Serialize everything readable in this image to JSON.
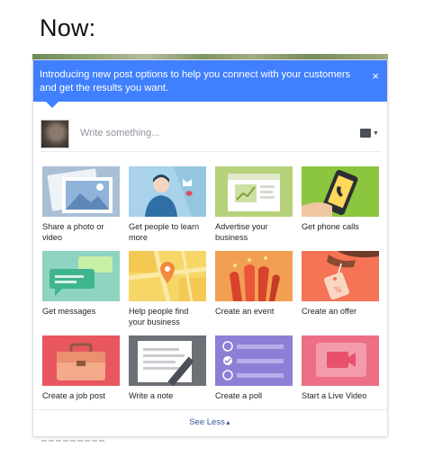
{
  "heading": "Now:",
  "banner": {
    "text": "Introducing new post options to help you connect with your customers and get the results you want.",
    "close_label": "×"
  },
  "composer": {
    "placeholder": "Write something..."
  },
  "options": [
    {
      "label": "Share a photo or video",
      "icon": "photo-icon"
    },
    {
      "label": "Get people to learn more",
      "icon": "person-learn-icon"
    },
    {
      "label": "Advertise your business",
      "icon": "advertise-icon"
    },
    {
      "label": "Get phone calls",
      "icon": "phone-icon"
    },
    {
      "label": "Get messages",
      "icon": "messages-icon"
    },
    {
      "label": "Help people find your business",
      "icon": "map-pin-icon"
    },
    {
      "label": "Create an event",
      "icon": "event-icon"
    },
    {
      "label": "Create an offer",
      "icon": "offer-tag-icon"
    },
    {
      "label": "Create a job post",
      "icon": "briefcase-icon"
    },
    {
      "label": "Write a note",
      "icon": "note-icon"
    },
    {
      "label": "Create a poll",
      "icon": "poll-icon"
    },
    {
      "label": "Start a Live Video",
      "icon": "live-video-icon"
    }
  ],
  "footer": {
    "see_less_label": "See Less",
    "arrow": "▲"
  },
  "colors": {
    "banner": "#4080ff",
    "link": "#365899"
  }
}
